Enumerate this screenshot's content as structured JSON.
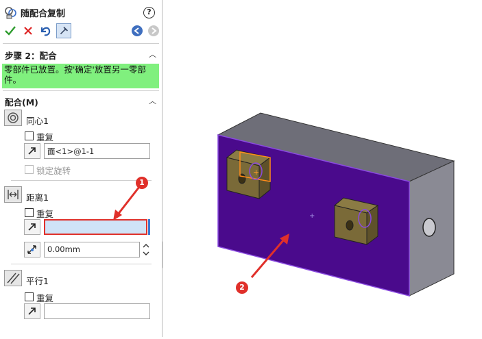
{
  "panel": {
    "title": "随配合复制",
    "help_label": "?",
    "step": {
      "header": "步骤 2：配合",
      "message": "零部件已放置。按'确定'放置另一零部件。"
    },
    "mates": {
      "header": "配合(M)",
      "concentric": {
        "label": "同心1",
        "repeat_label": "重复",
        "face_value": "面<1>@1-1",
        "lock_rotation_label": "锁定旋转"
      },
      "distance": {
        "label": "距离1",
        "repeat_label": "重复",
        "selection_value": "",
        "distance_value": "0.00mm"
      },
      "parallel": {
        "label": "平行1",
        "repeat_label": "重复",
        "selection_value": ""
      }
    }
  },
  "callouts": {
    "one": "1",
    "two": "2"
  },
  "colors": {
    "message_bg": "#80f07e",
    "highlight_face": "#4a0a8c",
    "block_top": "#6e6e78",
    "block_side": "#8a8a94",
    "boss": "#7a6a38",
    "annotation": "#e0302a"
  }
}
